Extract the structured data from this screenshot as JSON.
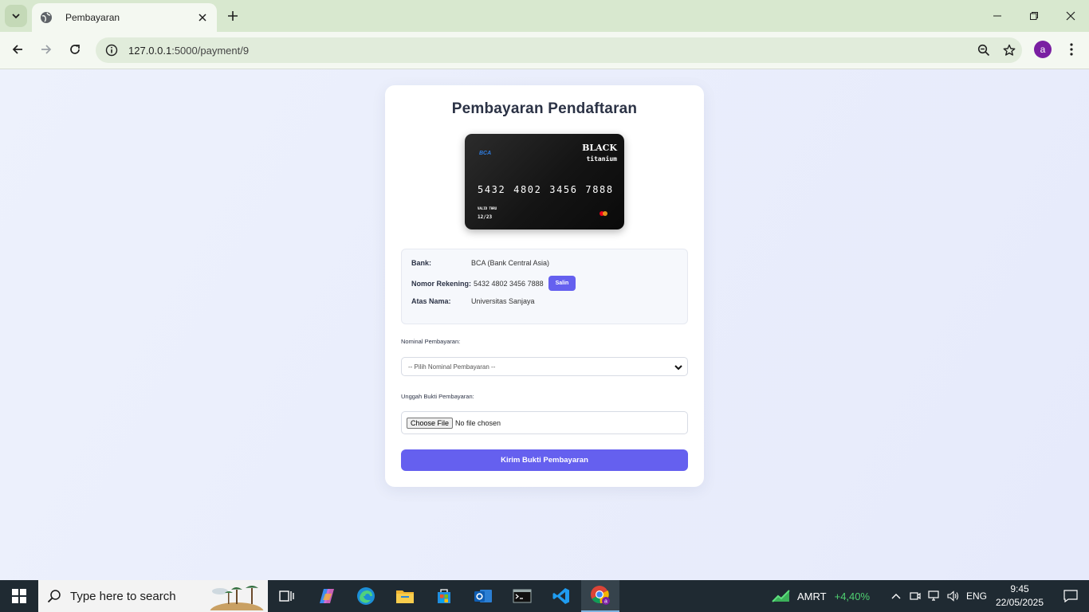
{
  "browser": {
    "tab_title": "Pembayaran",
    "url_host": "127.0.0.1",
    "url_path": ":5000/payment/9",
    "profile_initial": "a"
  },
  "page": {
    "title": "Pembayaran Pendaftaran",
    "card": {
      "bank_logo": "BCA",
      "brand_line1": "BLACK",
      "brand_line2": "titanium",
      "number": "5432 4802 3456 7888",
      "valid_label": "VALID THRU",
      "valid_date": "12/23"
    },
    "info": {
      "bank_label": "Bank:",
      "bank_value": "BCA (Bank Central Asia)",
      "account_label": "Nomor Rekening:",
      "account_value": "5432 4802 3456 7888",
      "copy_label": "Salin",
      "name_label": "Atas Nama:",
      "name_value": "Universitas Sanjaya"
    },
    "form": {
      "amount_label": "Nominal Pembayaran:",
      "amount_selected": "-- Pilih Nominal Pembayaran --",
      "upload_label": "Unggah Bukti Pembayaran:",
      "choose_file_label": "Choose File",
      "no_file_text": "No file chosen",
      "submit_label": "Kirim Bukti Pembayaran"
    }
  },
  "taskbar": {
    "search_placeholder": "Type here to search",
    "stock_name": "AMRT",
    "stock_change": "+4,40%",
    "language": "ENG",
    "time": "9:45",
    "date": "22/05/2025"
  },
  "colors": {
    "accent": "#6560ef",
    "chrome_bg": "#d8e8cf",
    "page_bg": "#e9eefb"
  }
}
